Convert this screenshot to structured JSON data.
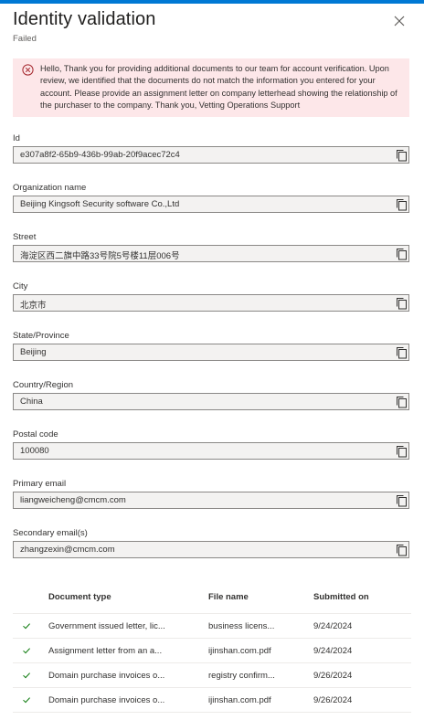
{
  "header": {
    "title": "Identity validation",
    "status": "Failed"
  },
  "alert": {
    "icon": "error-circle-icon",
    "message": "Hello, Thank you for providing additional documents to our team for account verification. Upon review, we identified that the documents do not match the information you entered for your account. Please provide an assignment letter on company letterhead showing the relationship of the purchaser to the company. Thank you, Vetting Operations Support"
  },
  "fields": [
    {
      "label": "Id",
      "value": "e307a8f2-65b9-436b-99ab-20f9acec72c4"
    },
    {
      "label": "Organization name",
      "value": "Beijing Kingsoft Security software Co.,Ltd"
    },
    {
      "label": "Street",
      "value": "海淀区西二旗中路33号院5号楼11层006号"
    },
    {
      "label": "City",
      "value": "北京市"
    },
    {
      "label": "State/Province",
      "value": "Beijing"
    },
    {
      "label": "Country/Region",
      "value": "China"
    },
    {
      "label": "Postal code",
      "value": "100080"
    },
    {
      "label": "Primary email",
      "value": "liangweicheng@cmcm.com"
    },
    {
      "label": "Secondary email(s)",
      "value": "zhangzexin@cmcm.com"
    }
  ],
  "documents": {
    "columns": [
      "Document type",
      "File name",
      "Submitted on"
    ],
    "rows": [
      {
        "type": "Government issued letter, lic...",
        "file": "business licens...",
        "date": "9/24/2024"
      },
      {
        "type": "Assignment letter from an a...",
        "file": "ijinshan.com.pdf",
        "date": "9/24/2024"
      },
      {
        "type": "Domain purchase invoices o...",
        "file": "registry confirm...",
        "date": "9/26/2024"
      },
      {
        "type": "Domain purchase invoices o...",
        "file": "ijinshan.com.pdf",
        "date": "9/26/2024"
      }
    ]
  },
  "colors": {
    "accent": "#0078d4",
    "error_background": "#fde7e9",
    "error_icon": "#a4262c",
    "success_check": "#107c10"
  }
}
